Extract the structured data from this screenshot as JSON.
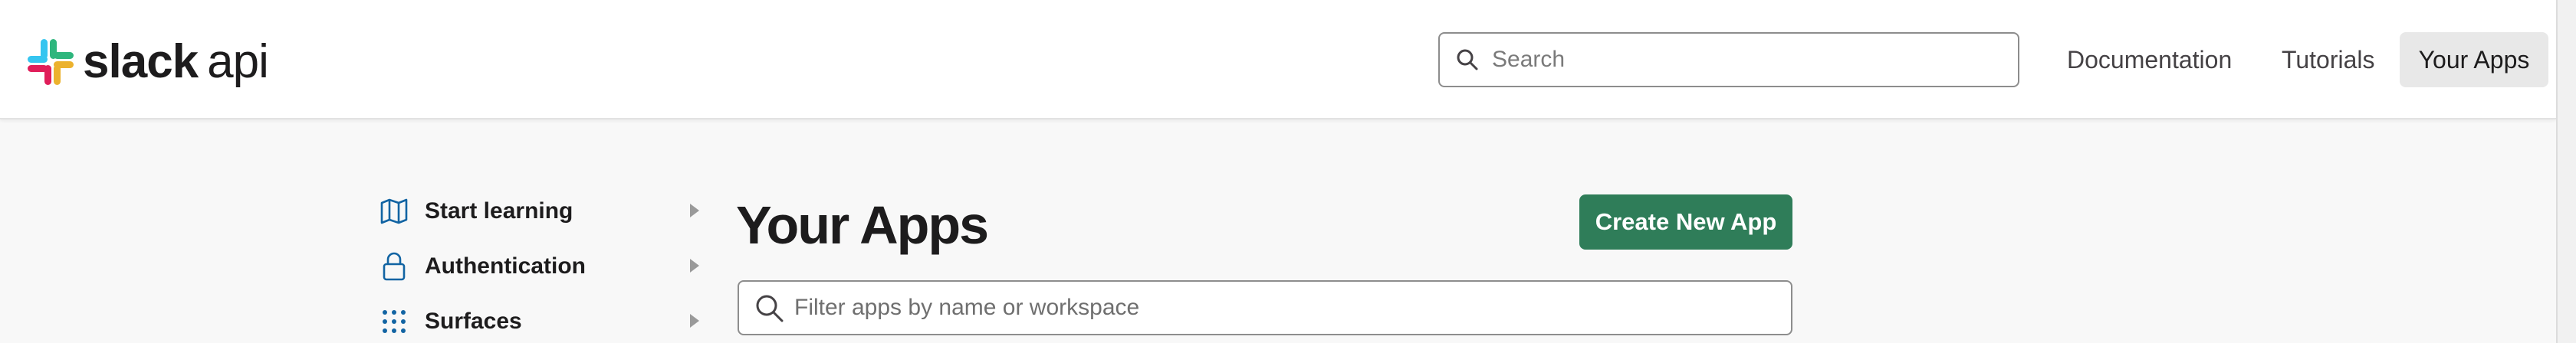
{
  "header": {
    "logo_word": "slack",
    "logo_suffix": "api",
    "search": {
      "placeholder": "Search"
    },
    "nav": {
      "documentation": "Documentation",
      "tutorials": "Tutorials",
      "your_apps": "Your Apps"
    }
  },
  "sidebar": {
    "items": [
      {
        "label": "Start learning",
        "icon": "map-icon"
      },
      {
        "label": "Authentication",
        "icon": "lock-icon"
      },
      {
        "label": "Surfaces",
        "icon": "grid-dots-icon"
      }
    ]
  },
  "main": {
    "title": "Your Apps",
    "create_button": "Create New App",
    "filter": {
      "placeholder": "Filter apps by name or workspace"
    }
  },
  "colors": {
    "accent_green": "#2f7d59",
    "icon_blue": "#1264a3",
    "slack_red": "#e01e5a",
    "slack_blue": "#36c5f0",
    "slack_green": "#2eb67d",
    "slack_yellow": "#ecb22e"
  }
}
